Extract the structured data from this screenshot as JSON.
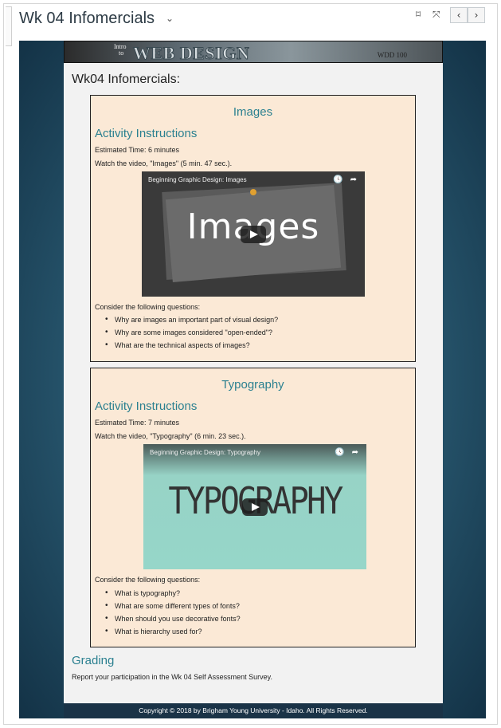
{
  "header": {
    "title": "Wk 04 Infomercials",
    "caret_icon": "chevron-down-icon",
    "bookmark_icon": "bookmark-icon",
    "fullscreen_icon": "expand-icon",
    "prev_icon": "chevron-left-icon",
    "next_icon": "chevron-right-icon",
    "caret_glyph": "⌄",
    "bookmark_glyph": "⌑",
    "fullscreen_glyph": "⤧",
    "prev_glyph": "‹",
    "next_glyph": "›"
  },
  "banner": {
    "intro_line1": "Intro",
    "intro_line2": "to",
    "title": "WEB DESIGN",
    "code": "WDD 100"
  },
  "page": {
    "heading": "Wk04  Infomercials:"
  },
  "sections": [
    {
      "title": "Images",
      "activity_title": "Activity Instructions",
      "estimated_time": "Estimated Time: 6 minutes",
      "watch_text": "Watch the video, \"Images\" (5 min. 47 sec.).",
      "video": {
        "title": "Beginning Graphic Design: Images",
        "display_text": "Images",
        "clock_glyph": "🕓",
        "share_glyph": "➦"
      },
      "questions_intro": "Consider the following questions:",
      "questions": [
        "Why are images an important part of visual design?",
        "Why are some images considered \"open-ended\"?",
        "What are the technical aspects of images?"
      ]
    },
    {
      "title": "Typography",
      "activity_title": "Activity Instructions",
      "estimated_time": "Estimated Time: 7 minutes",
      "watch_text": "Watch the video, \"Typography\" (6 min. 23 sec.).",
      "video": {
        "title": "Beginning Graphic Design: Typography",
        "display_text": "TYPOGRAPHY",
        "clock_glyph": "🕓",
        "share_glyph": "➦"
      },
      "questions_intro": "Consider the following questions:",
      "questions": [
        "What is typography?",
        "What are some different types of fonts?",
        "When should you use decorative fonts?",
        "What is hierarchy used for?"
      ]
    }
  ],
  "grading": {
    "title": "Grading",
    "text": "Report your participation in the Wk 04  Self Assessment Survey."
  },
  "footer": {
    "text": "Copyright © 2018 by Brigham Young University - Idaho. All Rights Reserved."
  },
  "colors": {
    "accent": "#2b8090",
    "box_bg": "#fbe9d6",
    "footer_bg": "#1a3347",
    "page_bg": "#f2f2f2"
  }
}
